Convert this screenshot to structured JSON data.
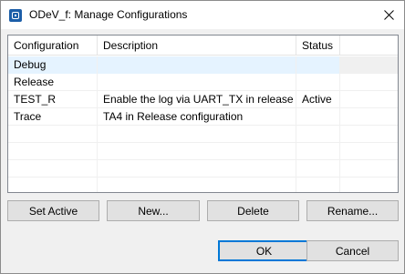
{
  "window": {
    "title": "ODeV_f: Manage Configurations"
  },
  "table": {
    "headers": [
      "Configuration",
      "Description",
      "Status"
    ],
    "rows": [
      {
        "config": "Debug",
        "description": "",
        "status": ""
      },
      {
        "config": "Release",
        "description": "",
        "status": ""
      },
      {
        "config": "TEST_R",
        "description": "Enable the log via UART_TX in release",
        "status": "Active"
      },
      {
        "config": "Trace",
        "description": "TA4 in Release configuration",
        "status": ""
      }
    ],
    "selected_row": "Debug"
  },
  "actions": {
    "set_active": "Set Active",
    "new": "New...",
    "delete": "Delete",
    "rename": "Rename..."
  },
  "dialog": {
    "ok": "OK",
    "cancel": "Cancel"
  },
  "icons": {
    "app": "app-icon",
    "close": "close-icon"
  },
  "colors": {
    "selection": "#e5f3ff",
    "default_button_border": "#0078d7"
  }
}
